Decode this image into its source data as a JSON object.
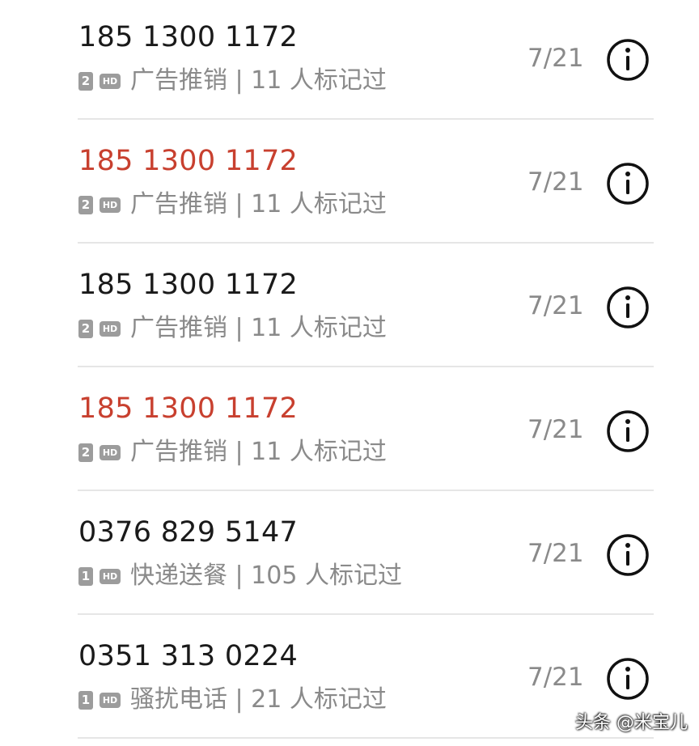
{
  "calls": [
    {
      "number": "185 1300 1172",
      "missed": false,
      "sim": "2",
      "hd": "HD",
      "tag": "广告推销 | 11 人标记过",
      "date": "7/21"
    },
    {
      "number": "185 1300 1172",
      "missed": true,
      "sim": "2",
      "hd": "HD",
      "tag": "广告推销 | 11 人标记过",
      "date": "7/21"
    },
    {
      "number": "185 1300 1172",
      "missed": false,
      "sim": "2",
      "hd": "HD",
      "tag": "广告推销 | 11 人标记过",
      "date": "7/21"
    },
    {
      "number": "185 1300 1172",
      "missed": true,
      "sim": "2",
      "hd": "HD",
      "tag": "广告推销 | 11 人标记过",
      "date": "7/21"
    },
    {
      "number": "0376 829 5147",
      "missed": false,
      "sim": "1",
      "hd": "HD",
      "tag": "快递送餐 | 105 人标记过",
      "date": "7/21"
    },
    {
      "number": "0351 313 0224",
      "missed": false,
      "sim": "1",
      "hd": "HD",
      "tag": "骚扰电话 | 21 人标记过",
      "date": "7/21"
    }
  ],
  "info_icon": "info-circle-icon",
  "watermark": "头条 @米宝儿",
  "colors": {
    "number_normal": "#1a1a1a",
    "number_missed": "#c8402f",
    "secondary_text": "#8a8a8a",
    "badge": "#9c9c9c",
    "divider": "#e6e6e6"
  }
}
